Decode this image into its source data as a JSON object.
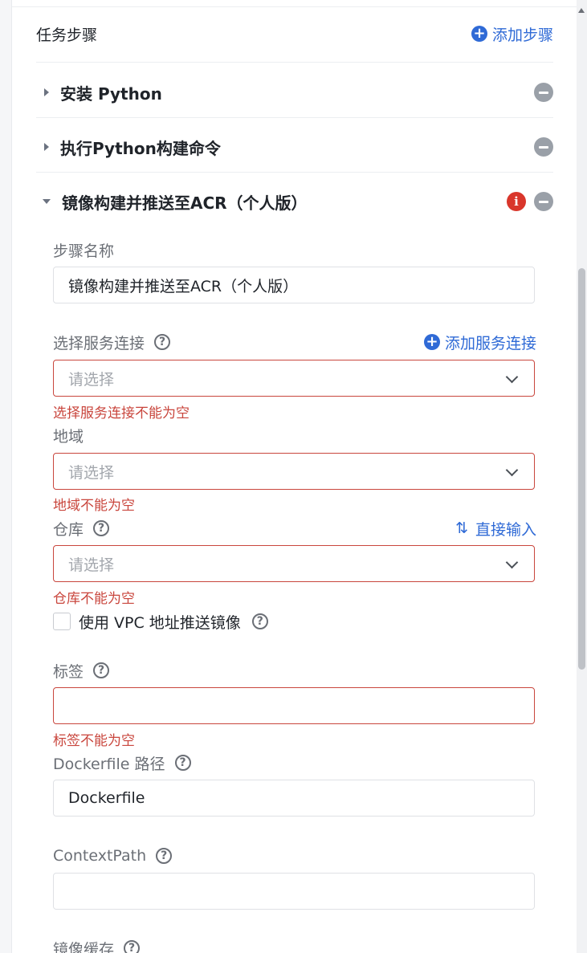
{
  "header": {
    "title": "任务步骤",
    "add_step": "添加步骤"
  },
  "steps": [
    {
      "title": "安装 Python"
    },
    {
      "title": "执行Python构建命令"
    },
    {
      "title": "镜像构建并推送至ACR（个人版）"
    }
  ],
  "form": {
    "step_name": {
      "label": "步骤名称",
      "value": "镜像构建并推送至ACR（个人版）"
    },
    "service_connection": {
      "label": "选择服务连接",
      "add_link": "添加服务连接",
      "placeholder": "请选择",
      "error": "选择服务连接不能为空"
    },
    "region": {
      "label": "地域",
      "placeholder": "请选择",
      "error": "地域不能为空"
    },
    "repository": {
      "label": "仓库",
      "direct_input": "直接输入",
      "placeholder": "请选择",
      "error": "仓库不能为空"
    },
    "vpc": {
      "label": "使用 VPC 地址推送镜像",
      "checked": false
    },
    "tag": {
      "label": "标签",
      "value": "",
      "error": "标签不能为空"
    },
    "dockerfile": {
      "label": "Dockerfile 路径",
      "value": "Dockerfile"
    },
    "context_path": {
      "label": "ContextPath",
      "value": ""
    },
    "image_cache": {
      "label": "镜像缓存"
    }
  },
  "icons": {
    "help": "?",
    "info": "i",
    "plus": "+",
    "swap": "⇅"
  },
  "colors": {
    "accent": "#2f6ad6",
    "error": "#c9463d",
    "info": "#d9362b",
    "muted": "#9aa0a8"
  }
}
